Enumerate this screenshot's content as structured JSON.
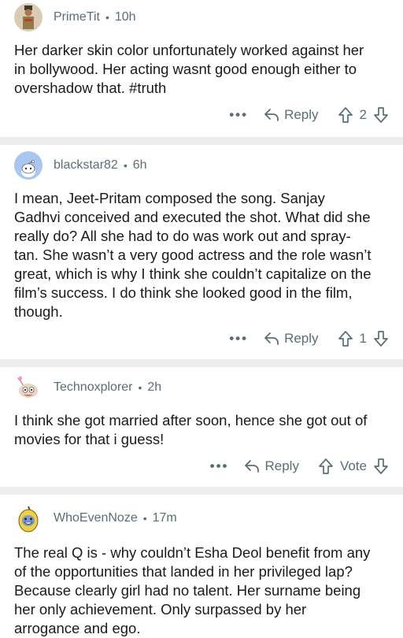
{
  "comments": [
    {
      "username": "PrimeTit",
      "time": "10h",
      "body": "Her darker skin color unfortunately worked against her in bollywood. Her acting wasnt good enough either to overshadow that. #truth",
      "reply_label": "Reply",
      "vote_count": "2",
      "avatar_icon": "soldier-avatar-icon"
    },
    {
      "username": "blackstar82",
      "time": "6h",
      "body": "I mean, Jeet-Pritam composed the song. Sanjay Gadhvi conceived and executed the shot. What did she really do? All she had to do was work out and spray-tan. She wasn’t a very good actress and the role wasn’t great, which is why I think she couldn’t capitalize on the film’s success. I do think she looked good in the film, though.",
      "reply_label": "Reply",
      "vote_count": "1",
      "avatar_icon": "snoo-avatar-icon"
    },
    {
      "username": "Technoxplorer",
      "time": "2h",
      "body": "I think she got married after soon, hence she got out of movies for that i guess!",
      "reply_label": "Reply",
      "vote_count": "Vote",
      "avatar_icon": "creature-avatar-icon"
    },
    {
      "username": "WhoEvenNoze",
      "time": "17m",
      "body": "The real Q is - why couldn’t Esha Deol benefit from any of the opportunities that landed in her privileged lap? Because clearly girl had no talent. Her surname being her only achievement. Only surpassed by her arrogance and ego.",
      "reply_label": "",
      "vote_count": "",
      "avatar_icon": "banana-avatar-icon"
    }
  ],
  "more_label": "•••",
  "colors": {
    "meta": "#576f76",
    "divider": "#ededed",
    "text": "#1a1a1b"
  }
}
